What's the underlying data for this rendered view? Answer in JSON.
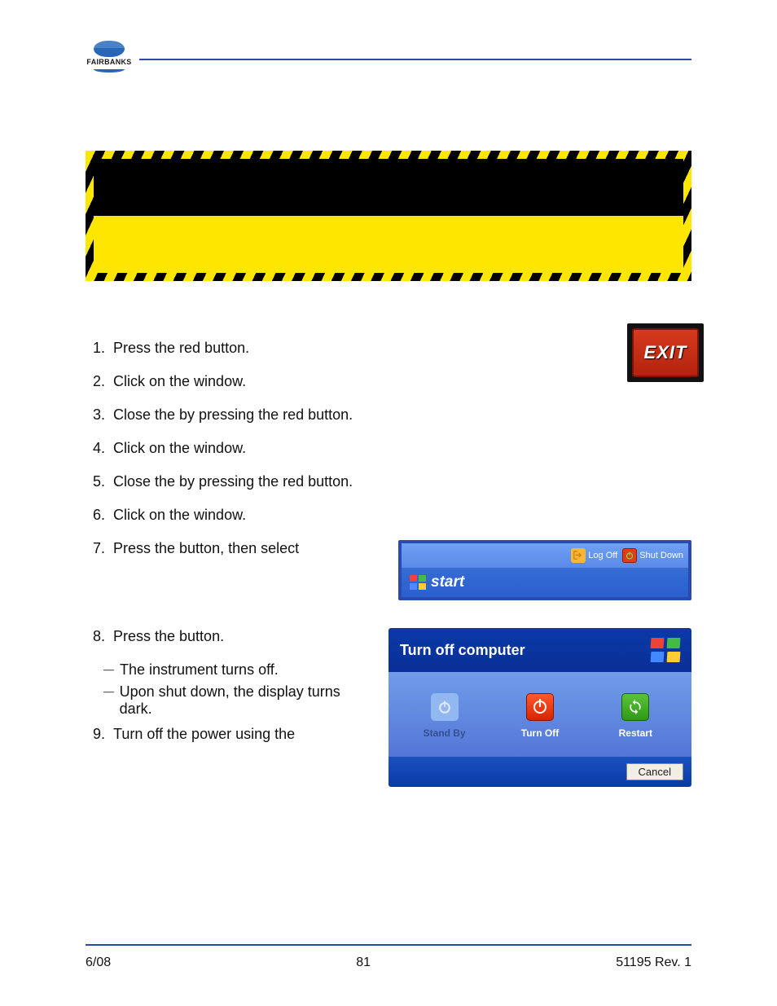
{
  "logo": {
    "brand": "FAIRBANKS"
  },
  "steps": [
    {
      "n": "1.",
      "text": "Press the red          button."
    },
    {
      "n": "2.",
      "text": "Click         on the                                    window."
    },
    {
      "n": "3.",
      "text": "Close the                                 by pressing the red           button."
    },
    {
      "n": "4.",
      "text": "Click         on the                                    window."
    },
    {
      "n": "5.",
      "text": "Close the                             by pressing the red           button."
    },
    {
      "n": "6.",
      "text": "Click         on the                                    window."
    }
  ],
  "step7": {
    "n": "7.",
    "text": "Press the           button, then select"
  },
  "step8": {
    "n": "8.",
    "text": "Press the                  button."
  },
  "step8sub": [
    "The instrument turns off.",
    "Upon shut down, the display turns dark."
  ],
  "step9": {
    "n": "9.",
    "text": "Turn off the power using the"
  },
  "exit_button": {
    "label": "EXIT"
  },
  "start_menu": {
    "logoff": "Log Off",
    "shutdown": "Shut Down",
    "start": "start"
  },
  "turnoff_dialog": {
    "title": "Turn off computer",
    "standby": "Stand By",
    "turnoff": "Turn Off",
    "restart": "Restart",
    "cancel": "Cancel"
  },
  "footer": {
    "left": "6/08",
    "center": "81",
    "right": "51195    Rev. 1"
  }
}
